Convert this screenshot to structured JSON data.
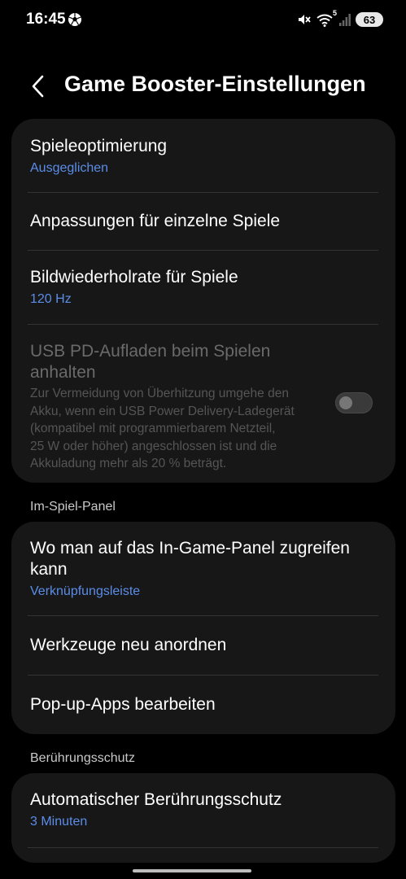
{
  "status_bar": {
    "time": "16:45",
    "left_icon": "soccer-ball-icon",
    "right_icons": [
      "mute-icon",
      "wifi-icon",
      "signal-icon"
    ],
    "wifi_badge": "5",
    "battery": "63"
  },
  "header": {
    "back_icon": "chevron-left-icon",
    "title": "Game Booster-Einstellungen"
  },
  "card1": {
    "items": [
      {
        "title": "Spieleoptimierung",
        "subtitle": "Ausgeglichen"
      },
      {
        "title": "Anpassungen für einzelne Spiele"
      },
      {
        "title": "Bildwiederholrate für Spiele",
        "subtitle": "120 Hz"
      },
      {
        "title_line1": "USB PD-Aufladen beim Spielen",
        "title_line2": "anhalten",
        "desc_lines": [
          "Zur Vermeidung von Überhitzung umgehe den",
          "Akku, wenn ein USB Power Delivery-Ladegerät",
          "(kompatibel mit programmierbarem Netzteil,",
          "25 W oder höher) angeschlossen ist und die",
          "Akkuladung mehr als 20 % beträgt."
        ],
        "toggle_on": false,
        "enabled": false
      }
    ]
  },
  "section2": {
    "header": "Im-Spiel-Panel",
    "items": [
      {
        "title_line1": "Wo man auf das In-Game-Panel zugreifen",
        "title_line2": "kann",
        "subtitle": "Verknüpfungsleiste"
      },
      {
        "title": "Werkzeuge neu anordnen"
      },
      {
        "title": "Pop-up-Apps bearbeiten"
      }
    ]
  },
  "section3": {
    "header": "Berührungsschutz",
    "items": [
      {
        "title": "Automatischer Berührungsschutz",
        "subtitle": "3 Minuten"
      }
    ]
  },
  "colors": {
    "background": "#000000",
    "card": "#171717",
    "accent": "#5b8de8",
    "disabled_text": "#6a6a6a"
  }
}
